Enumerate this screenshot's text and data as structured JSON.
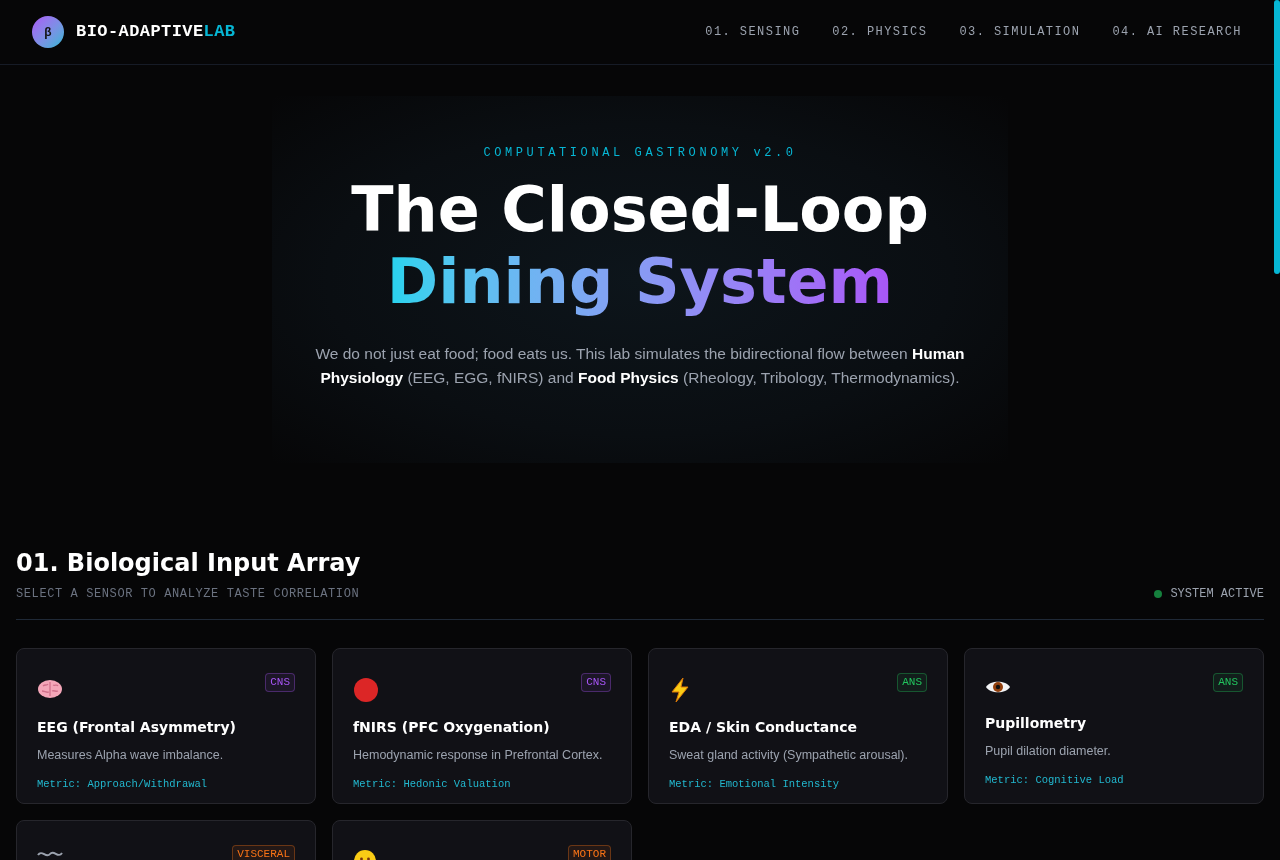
{
  "brand": {
    "logo_letter": "β",
    "name": "BIO-ADAPTIVE",
    "name_accent": "LAB"
  },
  "nav": [
    {
      "label": "01. SENSING"
    },
    {
      "label": "02. PHYSICS"
    },
    {
      "label": "03. SIMULATION"
    },
    {
      "label": "04. AI RESEARCH"
    }
  ],
  "hero": {
    "eyebrow": "COMPUTATIONAL GASTRONOMY v2.0",
    "title_line1": "The Closed-Loop",
    "title_line2": "Dining System",
    "intro": "We do not just eat food; food eats us. This lab simulates the bidirectional flow between **Human Physiology** (EEG, EGG, fNIRS) and **Food Physics** (Rheology, Tribology, Thermodynamics)."
  },
  "section": {
    "title": "01. Biological Input Array",
    "subtitle": "SELECT A SENSOR TO ANALYZE TASTE CORRELATION",
    "status": "SYSTEM ACTIVE"
  },
  "sensors": [
    {
      "tag": "CNS",
      "color": "#a855f7",
      "title": "EEG (Frontal Asymmetry)",
      "description": "Measures Alpha wave imbalance.",
      "metric": "Metric: Approach/Withdrawal"
    },
    {
      "tag": "CNS",
      "color": "#a855f7",
      "title": "fNIRS (PFC Oxygenation)",
      "description": "Hemodynamic response in Prefrontal Cortex.",
      "metric": "Metric: Hedonic Valuation"
    },
    {
      "tag": "ANS",
      "color": "#22c55e",
      "title": "EDA / Skin Conductance",
      "description": "Sweat gland activity (Sympathetic arousal).",
      "metric": "Metric: Emotional Intensity"
    },
    {
      "tag": "ANS",
      "color": "#22c55e",
      "title": "Pupillometry",
      "description": "Pupil dilation diameter.",
      "metric": "Metric: Cognitive Load"
    },
    {
      "tag": "VISCERAL",
      "color": "#f97316"
    },
    {
      "tag": "MOTOR",
      "color": "#f97316"
    }
  ]
}
